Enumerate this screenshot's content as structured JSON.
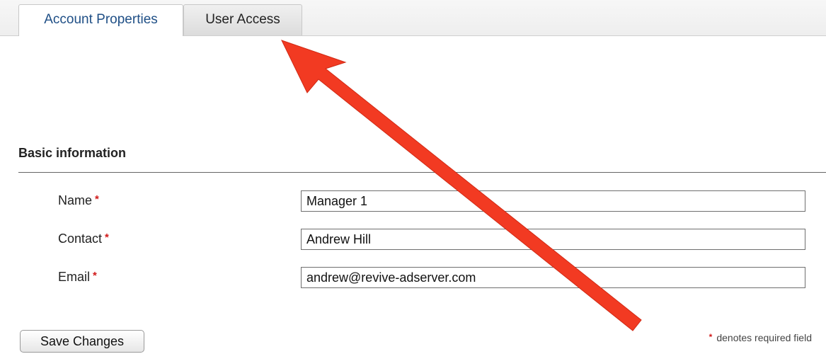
{
  "tabs": [
    {
      "label": "Account Properties",
      "active": true
    },
    {
      "label": "User Access",
      "active": false
    }
  ],
  "section": {
    "title": "Basic information"
  },
  "form": {
    "fields": [
      {
        "label": "Name",
        "value": "Manager 1",
        "required": true
      },
      {
        "label": "Contact",
        "value": "Andrew Hill",
        "required": true
      },
      {
        "label": "Email",
        "value": "andrew@revive-adserver.com",
        "required": true
      }
    ],
    "required_marker": "*",
    "save_label": "Save Changes",
    "required_note": "denotes required field"
  },
  "colors": {
    "active_tab_text": "#1f4f86",
    "required_star": "#d11a1a",
    "annotation_arrow": "#f23a22"
  }
}
